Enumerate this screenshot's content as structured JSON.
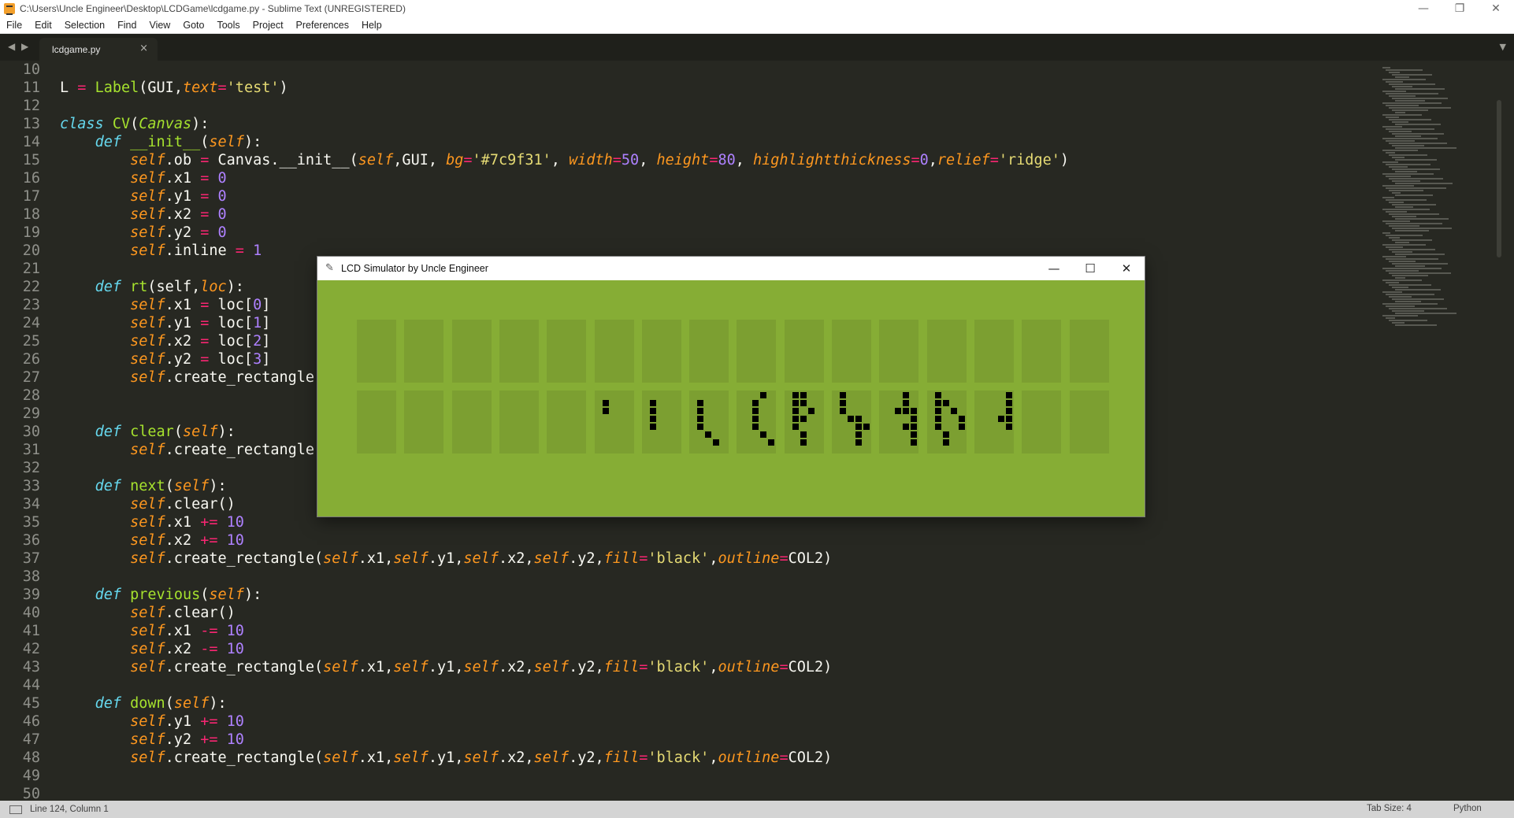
{
  "window": {
    "title": "C:\\Users\\Uncle Engineer\\Desktop\\LCDGame\\lcdgame.py - Sublime Text (UNREGISTERED)",
    "controls": {
      "minimize": "—",
      "restore": "❐",
      "close": "✕"
    }
  },
  "menu": [
    "File",
    "Edit",
    "Selection",
    "Find",
    "View",
    "Goto",
    "Tools",
    "Project",
    "Preferences",
    "Help"
  ],
  "tabs": {
    "nav": "◀ ▶",
    "active_label": "lcdgame.py",
    "close": "×",
    "dropdown": "▼"
  },
  "code_lines": [
    {
      "n": "10",
      "t": []
    },
    {
      "n": "11",
      "t": [
        [
          "",
          "L "
        ],
        [
          "op",
          "="
        ],
        [
          "",
          " "
        ],
        [
          "fn",
          "Label"
        ],
        [
          "",
          "(GUI,"
        ],
        [
          "arg",
          "text"
        ],
        [
          "op",
          "="
        ],
        [
          "str",
          "'test'"
        ],
        [
          "",
          ")"
        ]
      ]
    },
    {
      "n": "12",
      "t": []
    },
    {
      "n": "13",
      "t": [
        [
          "kw",
          "class"
        ],
        [
          "",
          " "
        ],
        [
          "fn",
          "CV"
        ],
        [
          "",
          "("
        ],
        [
          "cls",
          "Canvas"
        ],
        [
          "",
          "):"
        ]
      ]
    },
    {
      "n": "14",
      "t": [
        [
          "",
          "    "
        ],
        [
          "kw",
          "def"
        ],
        [
          "",
          " "
        ],
        [
          "fn",
          "__init__"
        ],
        [
          "",
          "("
        ],
        [
          "self",
          "self"
        ],
        [
          "",
          "):"
        ]
      ]
    },
    {
      "n": "15",
      "t": [
        [
          "",
          "        "
        ],
        [
          "self",
          "self"
        ],
        [
          "",
          ".ob "
        ],
        [
          "op",
          "="
        ],
        [
          "",
          " Canvas.__init__("
        ],
        [
          "self",
          "self"
        ],
        [
          "",
          ",GUI, "
        ],
        [
          "arg",
          "bg"
        ],
        [
          "op",
          "="
        ],
        [
          "str",
          "'#7c9f31'"
        ],
        [
          "",
          ", "
        ],
        [
          "arg",
          "width"
        ],
        [
          "op",
          "="
        ],
        [
          "num",
          "50"
        ],
        [
          "",
          ", "
        ],
        [
          "arg",
          "height"
        ],
        [
          "op",
          "="
        ],
        [
          "num",
          "80"
        ],
        [
          "",
          ", "
        ],
        [
          "arg",
          "highlightthickness"
        ],
        [
          "op",
          "="
        ],
        [
          "num",
          "0"
        ],
        [
          "",
          ","
        ],
        [
          "arg",
          "relief"
        ],
        [
          "op",
          "="
        ],
        [
          "str",
          "'ridge'"
        ],
        [
          "",
          ")"
        ]
      ]
    },
    {
      "n": "16",
      "t": [
        [
          "",
          "        "
        ],
        [
          "self",
          "self"
        ],
        [
          "",
          ".x1 "
        ],
        [
          "op",
          "="
        ],
        [
          "",
          " "
        ],
        [
          "num",
          "0"
        ]
      ]
    },
    {
      "n": "17",
      "t": [
        [
          "",
          "        "
        ],
        [
          "self",
          "self"
        ],
        [
          "",
          ".y1 "
        ],
        [
          "op",
          "="
        ],
        [
          "",
          " "
        ],
        [
          "num",
          "0"
        ]
      ]
    },
    {
      "n": "18",
      "t": [
        [
          "",
          "        "
        ],
        [
          "self",
          "self"
        ],
        [
          "",
          ".x2 "
        ],
        [
          "op",
          "="
        ],
        [
          "",
          " "
        ],
        [
          "num",
          "0"
        ]
      ]
    },
    {
      "n": "19",
      "t": [
        [
          "",
          "        "
        ],
        [
          "self",
          "self"
        ],
        [
          "",
          ".y2 "
        ],
        [
          "op",
          "="
        ],
        [
          "",
          " "
        ],
        [
          "num",
          "0"
        ]
      ]
    },
    {
      "n": "20",
      "t": [
        [
          "",
          "        "
        ],
        [
          "self",
          "self"
        ],
        [
          "",
          ".inline "
        ],
        [
          "op",
          "="
        ],
        [
          "",
          " "
        ],
        [
          "num",
          "1"
        ]
      ]
    },
    {
      "n": "21",
      "t": []
    },
    {
      "n": "22",
      "t": [
        [
          "",
          "    "
        ],
        [
          "kw",
          "def"
        ],
        [
          "",
          " "
        ],
        [
          "fn",
          "rt"
        ],
        [
          "",
          "(self,"
        ],
        [
          "arg",
          "loc"
        ],
        [
          "",
          "):"
        ]
      ]
    },
    {
      "n": "23",
      "t": [
        [
          "",
          "        "
        ],
        [
          "self",
          "self"
        ],
        [
          "",
          ".x1 "
        ],
        [
          "op",
          "="
        ],
        [
          "",
          " loc["
        ],
        [
          "num",
          "0"
        ],
        [
          "",
          "]"
        ]
      ]
    },
    {
      "n": "24",
      "t": [
        [
          "",
          "        "
        ],
        [
          "self",
          "self"
        ],
        [
          "",
          ".y1 "
        ],
        [
          "op",
          "="
        ],
        [
          "",
          " loc["
        ],
        [
          "num",
          "1"
        ],
        [
          "",
          "]"
        ]
      ]
    },
    {
      "n": "25",
      "t": [
        [
          "",
          "        "
        ],
        [
          "self",
          "self"
        ],
        [
          "",
          ".x2 "
        ],
        [
          "op",
          "="
        ],
        [
          "",
          " loc["
        ],
        [
          "num",
          "2"
        ],
        [
          "",
          "]"
        ]
      ]
    },
    {
      "n": "26",
      "t": [
        [
          "",
          "        "
        ],
        [
          "self",
          "self"
        ],
        [
          "",
          ".y2 "
        ],
        [
          "op",
          "="
        ],
        [
          "",
          " loc["
        ],
        [
          "num",
          "3"
        ],
        [
          "",
          "]"
        ]
      ]
    },
    {
      "n": "27",
      "t": [
        [
          "",
          "        "
        ],
        [
          "self",
          "self"
        ],
        [
          "",
          ".create_rectangle("
        ]
      ]
    },
    {
      "n": "28",
      "t": []
    },
    {
      "n": "29",
      "t": []
    },
    {
      "n": "30",
      "t": [
        [
          "",
          "    "
        ],
        [
          "kw",
          "def"
        ],
        [
          "",
          " "
        ],
        [
          "fn",
          "clear"
        ],
        [
          "",
          "("
        ],
        [
          "self",
          "self"
        ],
        [
          "",
          "):"
        ]
      ]
    },
    {
      "n": "31",
      "t": [
        [
          "",
          "        "
        ],
        [
          "self",
          "self"
        ],
        [
          "",
          ".create_rectangle("
        ]
      ]
    },
    {
      "n": "32",
      "t": []
    },
    {
      "n": "33",
      "t": [
        [
          "",
          "    "
        ],
        [
          "kw",
          "def"
        ],
        [
          "",
          " "
        ],
        [
          "fn",
          "next"
        ],
        [
          "",
          "("
        ],
        [
          "self",
          "self"
        ],
        [
          "",
          "):"
        ]
      ]
    },
    {
      "n": "34",
      "t": [
        [
          "",
          "        "
        ],
        [
          "self",
          "self"
        ],
        [
          "",
          ".clear()"
        ]
      ]
    },
    {
      "n": "35",
      "t": [
        [
          "",
          "        "
        ],
        [
          "self",
          "self"
        ],
        [
          "",
          ".x1 "
        ],
        [
          "op",
          "+="
        ],
        [
          "",
          " "
        ],
        [
          "num",
          "10"
        ]
      ]
    },
    {
      "n": "36",
      "t": [
        [
          "",
          "        "
        ],
        [
          "self",
          "self"
        ],
        [
          "",
          ".x2 "
        ],
        [
          "op",
          "+="
        ],
        [
          "",
          " "
        ],
        [
          "num",
          "10"
        ]
      ]
    },
    {
      "n": "37",
      "t": [
        [
          "",
          "        "
        ],
        [
          "self",
          "self"
        ],
        [
          "",
          ".create_rectangle("
        ],
        [
          "self",
          "self"
        ],
        [
          "",
          ".x1,"
        ],
        [
          "self",
          "self"
        ],
        [
          "",
          ".y1,"
        ],
        [
          "self",
          "self"
        ],
        [
          "",
          ".x2,"
        ],
        [
          "self",
          "self"
        ],
        [
          "",
          ".y2,"
        ],
        [
          "arg",
          "fill"
        ],
        [
          "op",
          "="
        ],
        [
          "str",
          "'black'"
        ],
        [
          "",
          ","
        ],
        [
          "arg",
          "outline"
        ],
        [
          "op",
          "="
        ],
        [
          "",
          "COL2)"
        ]
      ]
    },
    {
      "n": "38",
      "t": []
    },
    {
      "n": "39",
      "t": [
        [
          "",
          "    "
        ],
        [
          "kw",
          "def"
        ],
        [
          "",
          " "
        ],
        [
          "fn",
          "previous"
        ],
        [
          "",
          "("
        ],
        [
          "self",
          "self"
        ],
        [
          "",
          "):"
        ]
      ]
    },
    {
      "n": "40",
      "t": [
        [
          "",
          "        "
        ],
        [
          "self",
          "self"
        ],
        [
          "",
          ".clear()"
        ]
      ]
    },
    {
      "n": "41",
      "t": [
        [
          "",
          "        "
        ],
        [
          "self",
          "self"
        ],
        [
          "",
          ".x1 "
        ],
        [
          "op",
          "-="
        ],
        [
          "",
          " "
        ],
        [
          "num",
          "10"
        ]
      ]
    },
    {
      "n": "42",
      "t": [
        [
          "",
          "        "
        ],
        [
          "self",
          "self"
        ],
        [
          "",
          ".x2 "
        ],
        [
          "op",
          "-="
        ],
        [
          "",
          " "
        ],
        [
          "num",
          "10"
        ]
      ]
    },
    {
      "n": "43",
      "t": [
        [
          "",
          "        "
        ],
        [
          "self",
          "self"
        ],
        [
          "",
          ".create_rectangle("
        ],
        [
          "self",
          "self"
        ],
        [
          "",
          ".x1,"
        ],
        [
          "self",
          "self"
        ],
        [
          "",
          ".y1,"
        ],
        [
          "self",
          "self"
        ],
        [
          "",
          ".x2,"
        ],
        [
          "self",
          "self"
        ],
        [
          "",
          ".y2,"
        ],
        [
          "arg",
          "fill"
        ],
        [
          "op",
          "="
        ],
        [
          "str",
          "'black'"
        ],
        [
          "",
          ","
        ],
        [
          "arg",
          "outline"
        ],
        [
          "op",
          "="
        ],
        [
          "",
          "COL2)"
        ]
      ]
    },
    {
      "n": "44",
      "t": []
    },
    {
      "n": "45",
      "t": [
        [
          "",
          "    "
        ],
        [
          "kw",
          "def"
        ],
        [
          "",
          " "
        ],
        [
          "fn",
          "down"
        ],
        [
          "",
          "("
        ],
        [
          "self",
          "self"
        ],
        [
          "",
          "):"
        ]
      ]
    },
    {
      "n": "46",
      "t": [
        [
          "",
          "        "
        ],
        [
          "self",
          "self"
        ],
        [
          "",
          ".y1 "
        ],
        [
          "op",
          "+="
        ],
        [
          "",
          " "
        ],
        [
          "num",
          "10"
        ]
      ]
    },
    {
      "n": "47",
      "t": [
        [
          "",
          "        "
        ],
        [
          "self",
          "self"
        ],
        [
          "",
          ".y2 "
        ],
        [
          "op",
          "+="
        ],
        [
          "",
          " "
        ],
        [
          "num",
          "10"
        ]
      ]
    },
    {
      "n": "48",
      "t": [
        [
          "",
          "        "
        ],
        [
          "self",
          "self"
        ],
        [
          "",
          ".create_rectangle("
        ],
        [
          "self",
          "self"
        ],
        [
          "",
          ".x1,"
        ],
        [
          "self",
          "self"
        ],
        [
          "",
          ".y1,"
        ],
        [
          "self",
          "self"
        ],
        [
          "",
          ".x2,"
        ],
        [
          "self",
          "self"
        ],
        [
          "",
          ".y2,"
        ],
        [
          "arg",
          "fill"
        ],
        [
          "op",
          "="
        ],
        [
          "str",
          "'black'"
        ],
        [
          "",
          ","
        ],
        [
          "arg",
          "outline"
        ],
        [
          "op",
          "="
        ],
        [
          "",
          "COL2)"
        ]
      ]
    },
    {
      "n": "49",
      "t": []
    },
    {
      "n": "50",
      "t": []
    }
  ],
  "lcd": {
    "title": "LCD Simulator by Uncle Engineer",
    "controls": {
      "minimize": "—",
      "maximize": "☐",
      "close": "✕"
    },
    "window_bg": "#86ad35",
    "cell_bg": "#7c9f31",
    "columns": 16,
    "rows": 2,
    "row2_pixels": [
      [],
      [],
      [],
      [],
      [],
      [
        [
          0,
          1
        ],
        [
          0,
          2
        ]
      ],
      [
        [
          0,
          1
        ],
        [
          0,
          2
        ],
        [
          0,
          3
        ],
        [
          0,
          4
        ]
      ],
      [
        [
          0,
          1
        ],
        [
          0,
          2
        ],
        [
          0,
          3
        ],
        [
          0,
          4
        ],
        [
          1,
          5
        ],
        [
          2,
          6
        ]
      ],
      [
        [
          1,
          1
        ],
        [
          1,
          2
        ],
        [
          1,
          3
        ],
        [
          1,
          4
        ],
        [
          2,
          0
        ],
        [
          2,
          5
        ],
        [
          3,
          6
        ]
      ],
      [
        [
          0,
          0
        ],
        [
          1,
          0
        ],
        [
          0,
          1
        ],
        [
          1,
          1
        ],
        [
          0,
          2
        ],
        [
          2,
          2
        ],
        [
          0,
          3
        ],
        [
          1,
          3
        ],
        [
          0,
          4
        ],
        [
          1,
          5
        ],
        [
          1,
          6
        ]
      ],
      [
        [
          0,
          0
        ],
        [
          0,
          1
        ],
        [
          0,
          2
        ],
        [
          1,
          3
        ],
        [
          2,
          3
        ],
        [
          2,
          4
        ],
        [
          3,
          4
        ],
        [
          2,
          5
        ],
        [
          2,
          6
        ]
      ],
      [
        [
          2,
          0
        ],
        [
          2,
          1
        ],
        [
          1,
          2
        ],
        [
          2,
          2
        ],
        [
          3,
          2
        ],
        [
          3,
          3
        ],
        [
          2,
          4
        ],
        [
          3,
          4
        ],
        [
          3,
          5
        ],
        [
          3,
          6
        ]
      ],
      [
        [
          0,
          0
        ],
        [
          0,
          1
        ],
        [
          1,
          1
        ],
        [
          0,
          2
        ],
        [
          2,
          2
        ],
        [
          0,
          3
        ],
        [
          3,
          3
        ],
        [
          0,
          4
        ],
        [
          3,
          4
        ],
        [
          1,
          5
        ],
        [
          1,
          6
        ]
      ],
      [
        [
          3,
          0
        ],
        [
          3,
          1
        ],
        [
          3,
          2
        ],
        [
          2,
          3
        ],
        [
          3,
          3
        ],
        [
          3,
          4
        ]
      ],
      [],
      []
    ]
  },
  "status": {
    "position": "Line 124, Column 1",
    "tab_size": "Tab Size: 4",
    "syntax": "Python"
  }
}
